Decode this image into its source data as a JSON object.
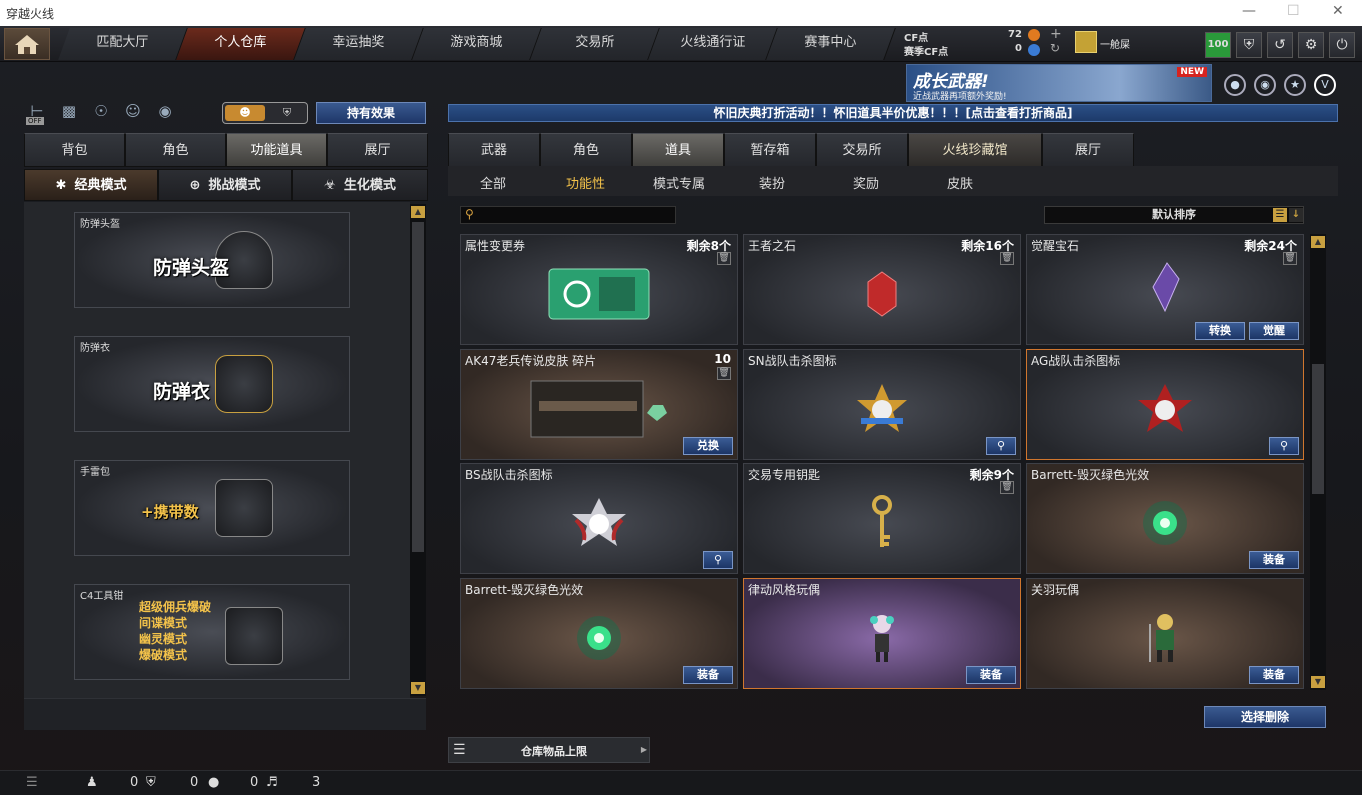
{
  "window": {
    "title": "穿越火线"
  },
  "nav": {
    "tabs": [
      "匹配大厅",
      "个人仓库",
      "幸运抽奖",
      "游戏商城",
      "交易所",
      "火线通行证",
      "赛事中心"
    ]
  },
  "currency": {
    "cf_label": "CF点",
    "cf_value": "72",
    "scf_label": "赛季CF点",
    "scf_value": "0"
  },
  "user": {
    "rank_name": "一舱屎",
    "level_badge": "100"
  },
  "banner": {
    "title": "成长武器!",
    "subtitle": "近战武器再项额外奖励!",
    "badge": "NEW"
  },
  "effects_button": "持有效果",
  "toggle": {
    "off_label": "OFF"
  },
  "notice": "怀旧庆典打折活动！！怀旧道具半价优惠！！！[点击查看打折商品]",
  "left_tabs": [
    "背包",
    "角色",
    "功能道具",
    "展厅"
  ],
  "modes": [
    "经典模式",
    "挑战模式",
    "生化模式"
  ],
  "left_cards": [
    {
      "title": "防弹头盔",
      "label": "防弹头盔"
    },
    {
      "title": "防弹衣",
      "label": "防弹衣"
    },
    {
      "title": "手雷包",
      "label": "+携带数"
    },
    {
      "title": "C4工具钳",
      "lines": [
        "超级佣兵爆破",
        "间谍模式",
        "幽灵模式",
        "爆破模式"
      ]
    }
  ],
  "main_tabs": [
    "武器",
    "角色",
    "道具",
    "暂存箱",
    "交易所",
    "火线珍藏馆",
    "展厅"
  ],
  "sub_tabs": [
    "全部",
    "功能性",
    "模式专属",
    "装扮",
    "奖励",
    "皮肤"
  ],
  "sort_label": "默认排序",
  "items": [
    {
      "name": "属性变更券",
      "remain": "剩余8个",
      "trash": true
    },
    {
      "name": "王者之石",
      "remain": "剩余16个",
      "trash": true
    },
    {
      "name": "觉醒宝石",
      "remain": "剩余24个",
      "trash": true,
      "buttons": [
        "转换",
        "觉醒"
      ]
    },
    {
      "name": "AK47老兵传说皮肤 碎片",
      "remain": "10",
      "trash": true,
      "buttons": [
        "兑换"
      ]
    },
    {
      "name": "SN战队击杀图标",
      "remain": "",
      "mag": true
    },
    {
      "name": "AG战队击杀图标",
      "remain": "",
      "mag": true
    },
    {
      "name": "BS战队击杀图标",
      "remain": "",
      "mag": true
    },
    {
      "name": "交易专用钥匙",
      "remain": "剩余9个",
      "trash": true
    },
    {
      "name": "Barrett-毁灭绿色光效",
      "remain": "",
      "buttons": [
        "装备"
      ]
    },
    {
      "name": "Barrett-毁灭绿色光效",
      "remain": "",
      "buttons": [
        "装备"
      ]
    },
    {
      "name": "律动风格玩偶",
      "remain": "",
      "buttons": [
        "装备"
      ]
    },
    {
      "name": "关羽玩偶",
      "remain": "",
      "buttons": [
        "装备"
      ]
    }
  ],
  "delete_button": "选择删除",
  "capacity_label": "仓库物品上限",
  "status": {
    "count1": "0",
    "count2": "0",
    "count3": "0",
    "count4": "3"
  },
  "colors": {
    "accent": "#f3c24a",
    "button_blue": "#1e3668",
    "active_tab": "#6b2a1c"
  }
}
